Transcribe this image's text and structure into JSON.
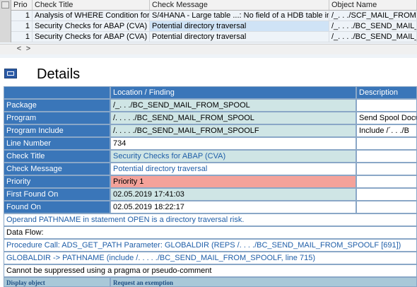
{
  "grid": {
    "columns": [
      "Prio",
      "Check Title",
      "Check Message",
      "Object Name"
    ],
    "rows": [
      {
        "prio": "1",
        "title": "Analysis of WHERE Condition for",
        "message": "S/4HANA - Large table ...: No field of a HDB table in",
        "object": "/_. . ./SCF_MAIL_FROM"
      },
      {
        "prio": "1",
        "title": "Security Checks for ABAP (CVA)",
        "message": "Potential directory traversal",
        "object": "/_. . . ./BC_SEND_MAIL_FRO"
      },
      {
        "prio": "1",
        "title": "Security Checks for ABAP (CVA)",
        "message": "Potential directory traversal",
        "object": "/_. . . ./BC_SEND_MAIL_FRO"
      }
    ],
    "scroll_left": "<",
    "scroll_right": ">"
  },
  "details": {
    "title": "Details",
    "header": {
      "location": "Location / Finding",
      "description": "Description"
    },
    "rows": [
      {
        "label": "Package",
        "value": "/_. . ./BC_SEND_MAIL_FROM_SPOOL",
        "desc": ""
      },
      {
        "label": "Program",
        "value": "/. . . . ./BC_SEND_MAIL_FROM_SPOOL",
        "desc": "Send Spool Docu"
      },
      {
        "label": "Program Include",
        "value": "/. . . . ./BC_SEND_MAIL_FROM_SPOOLF",
        "desc": "Include /´. . ./B"
      },
      {
        "label": "Line Number",
        "value": "734",
        "desc": ""
      },
      {
        "label": "Check Title",
        "value": "Security Checks for ABAP (CVA)",
        "desc": ""
      },
      {
        "label": "Check Message",
        "value": "Potential directory traversal",
        "desc": ""
      },
      {
        "label": "Priority",
        "value": "Priority 1",
        "desc": ""
      },
      {
        "label": "First Found On",
        "value": "02.05.2019 17:41:03",
        "desc": ""
      },
      {
        "label": "Found On",
        "value": "02.05.2019 18:22:17",
        "desc": ""
      }
    ],
    "notes": [
      "Operand PATHNAME in statement OPEN is a directory traversal risk.",
      "Data Flow:",
      "Procedure Call: ADS_GET_PATH Parameter: GLOBALDIR (REPS /. . . ./BC_SEND_MAIL_FROM_SPOOLF [691])",
      "GLOBALDIR -> PATHNAME (include /. . . . ./BC_SEND_MAIL_FROM_SPOOLF, line 715)",
      "Cannot be suppressed using a pragma or pseudo-comment"
    ],
    "footer": {
      "display": "Display object",
      "exemption": "Request an exemption"
    }
  },
  "colors": {
    "label_bg": "#3a76b9",
    "value_bg": "#cfe5e5",
    "priority_bg": "#f4a29a",
    "link": "#1f5ea8"
  }
}
